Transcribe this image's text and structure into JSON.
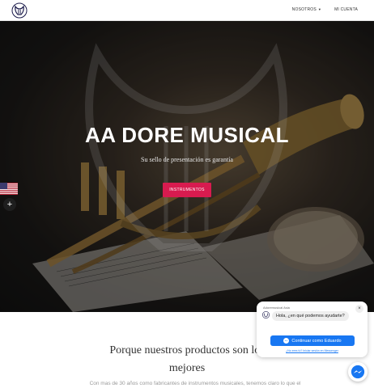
{
  "header": {
    "logo_icon": "lyre-logo-icon",
    "nav": [
      {
        "label": "NOSOTROS",
        "has_dropdown": true
      },
      {
        "label": "MI CUENTA",
        "has_dropdown": false
      }
    ]
  },
  "hero": {
    "title": "AA DORE MUSICAL",
    "subtitle": "Su sello de presentación es garantía",
    "cta_label": "INSTRUMENTOS",
    "watermark_text": "DORE MUSICAL",
    "background_icon": "trumpet-image"
  },
  "side_widgets": {
    "language_flag": "us-flag-icon",
    "plus_label": "+"
  },
  "section": {
    "title": "Porque nuestros productos son los mejores",
    "text": "Con mas de 30 años como fabricantes de instrumentos musicales, tenemos claro lo que el"
  },
  "chat": {
    "page_name": "Adoremusical Asia",
    "message": "Hola, ¿en qué podemos ayudarte?",
    "continue_label": "Continuar como Eduardo",
    "link_label": "¿No eres tú? Iniciar sesión en Messenger",
    "close_label": "×"
  },
  "colors": {
    "accent": "#d81b4f",
    "messenger_blue": "#1877f2"
  }
}
